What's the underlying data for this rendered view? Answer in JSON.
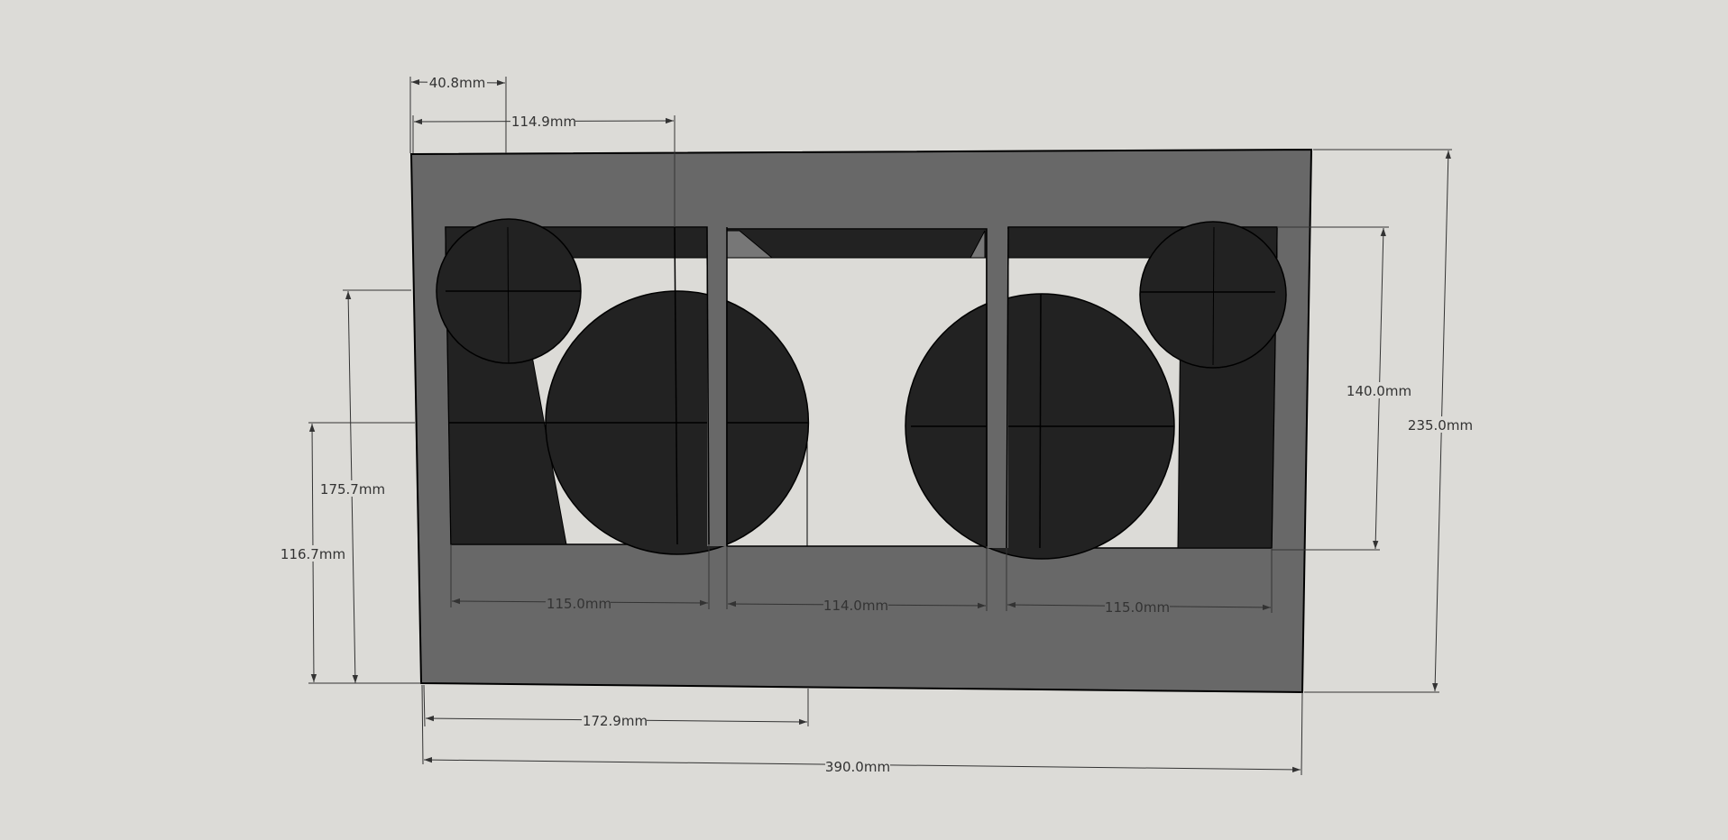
{
  "colors": {
    "background": "#dcdbd7",
    "panel": "#686868",
    "panel_stroke": "#000000",
    "cutout": "#dcdbd7",
    "driver": "#222222",
    "dim_line": "#333333"
  },
  "dimensions": {
    "d_40_8": "40.8mm",
    "d_114_9": "114.9mm",
    "d_175_7": "175.7mm",
    "d_116_7": "116.7mm",
    "d_115_left": "115.0mm",
    "d_114_0": "114.0mm",
    "d_115_right": "115.0mm",
    "d_172_9": "172.9mm",
    "d_390_0": "390.0mm",
    "d_140_0": "140.0mm",
    "d_235_0": "235.0mm"
  }
}
